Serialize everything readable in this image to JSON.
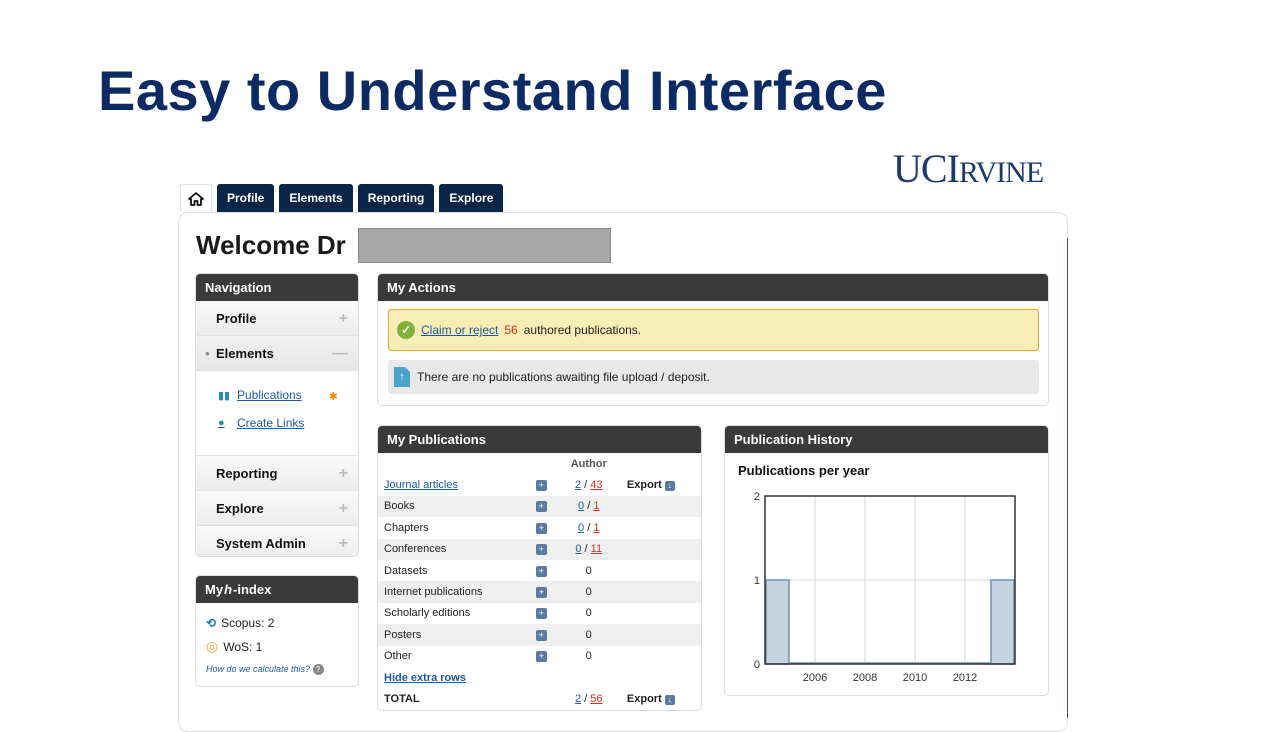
{
  "slide_title": "Easy to Understand Interface",
  "logo": {
    "uc": "UC",
    "irvine_big": "I",
    "irvine_small": "RVINE"
  },
  "tabs": [
    {
      "label": "Profile"
    },
    {
      "label": "Elements"
    },
    {
      "label": "Reporting"
    },
    {
      "label": "Explore"
    }
  ],
  "welcome": "Welcome Dr",
  "navigation": {
    "title": "Navigation",
    "items": [
      {
        "label": "Profile",
        "toggle": "+"
      },
      {
        "label": "Elements",
        "toggle": "—"
      },
      {
        "label": "Reporting",
        "toggle": "+"
      },
      {
        "label": "Explore",
        "toggle": "+"
      },
      {
        "label": "System Admin",
        "toggle": "+"
      }
    ],
    "sub": [
      {
        "label": "Publications",
        "icon": "books-icon"
      },
      {
        "label": "Create Links",
        "icon": "link-icon"
      }
    ]
  },
  "hindex": {
    "title_pre": "My ",
    "title_h": "h",
    "title_post": "-index",
    "scopus": "Scopus: 2",
    "wos": "WoS: 1",
    "help": "How do we calculate this?"
  },
  "actions": {
    "title": "My Actions",
    "claim_link": "Claim or reject",
    "claim_count": "56",
    "claim_text": "authored publications.",
    "upload_text": "There are no publications awaiting file upload / deposit."
  },
  "publications": {
    "title": "My Publications",
    "col_author": "Author",
    "export_label": "Export",
    "rows": [
      {
        "label": "Journal articles",
        "a": "2",
        "sep": " / ",
        "b": "43",
        "link": true,
        "export": true
      },
      {
        "label": "Books",
        "a": "0",
        "sep": " / ",
        "b": "1"
      },
      {
        "label": "Chapters",
        "a": "0",
        "sep": " / ",
        "b": "1"
      },
      {
        "label": "Conferences",
        "a": "0",
        "sep": " / ",
        "b": "11"
      },
      {
        "label": "Datasets",
        "a": "0",
        "sep": "",
        "b": ""
      },
      {
        "label": "Internet publications",
        "a": "0",
        "sep": "",
        "b": ""
      },
      {
        "label": "Scholarly editions",
        "a": "0",
        "sep": "",
        "b": ""
      },
      {
        "label": "Posters",
        "a": "0",
        "sep": "",
        "b": ""
      },
      {
        "label": "Other",
        "a": "0",
        "sep": "",
        "b": ""
      }
    ],
    "hide_rows": "Hide extra rows",
    "total_label": "TOTAL",
    "total_a": "2",
    "total_sep": " / ",
    "total_b": "56"
  },
  "history": {
    "title": "Publication History",
    "chart_title": "Publications per year"
  },
  "chart_data": {
    "type": "bar",
    "title": "Publications per year",
    "categories": [
      "2004",
      "2005",
      "2006",
      "2007",
      "2008",
      "2009",
      "2010",
      "2011",
      "2012",
      "2013"
    ],
    "values": [
      1,
      0,
      0,
      0,
      0,
      0,
      0,
      0,
      0,
      1
    ],
    "x_tick_labels": [
      "2006",
      "2008",
      "2010",
      "2012"
    ],
    "y_ticks": [
      "0",
      "1",
      "2"
    ],
    "ylim": [
      0,
      2
    ],
    "grid": true,
    "bar_color": "#c6d4e2",
    "bar_edge": "#6f8fb3"
  },
  "colors": {
    "title": "#0c2a63",
    "tab": "#0b2546",
    "panel_head": "#3a3a3a",
    "link": "#1d5aa6",
    "count": "#d03020"
  }
}
